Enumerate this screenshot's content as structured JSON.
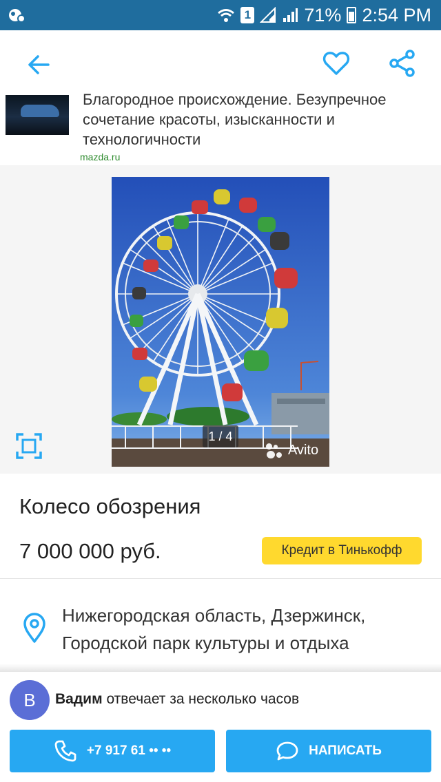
{
  "status_bar": {
    "sim": "1",
    "battery": "71%",
    "time": "2:54 PM"
  },
  "app_bar": {
    "back_icon": "arrow-left-icon",
    "favorite_icon": "heart-icon",
    "share_icon": "share-icon"
  },
  "ad": {
    "text": "Благородное происхождение. Безупречное сочетание красоты, изысканности и технологичности",
    "link": "mazda.ru"
  },
  "gallery": {
    "counter": "1 / 4",
    "watermark": "Avito"
  },
  "listing": {
    "title": "Колесо обозрения",
    "price": "7 000 000 руб.",
    "credit_button": "Кредит в Тинькофф",
    "address_line1": "Нижегородская область, Дзержинск,",
    "address_line2": "Городской парк культуры и отдыха"
  },
  "contact": {
    "avatar_letter": "В",
    "seller_name": "Вадим",
    "seller_status": "отвечает за несколько часов",
    "call_button": "+7 917 61 •• ••",
    "write_button": "НАПИСАТЬ"
  },
  "colors": {
    "status_bar": "#1f6d9e",
    "accent": "#27a8f2",
    "credit": "#ffd92e",
    "avatar": "#5b6ed6"
  }
}
